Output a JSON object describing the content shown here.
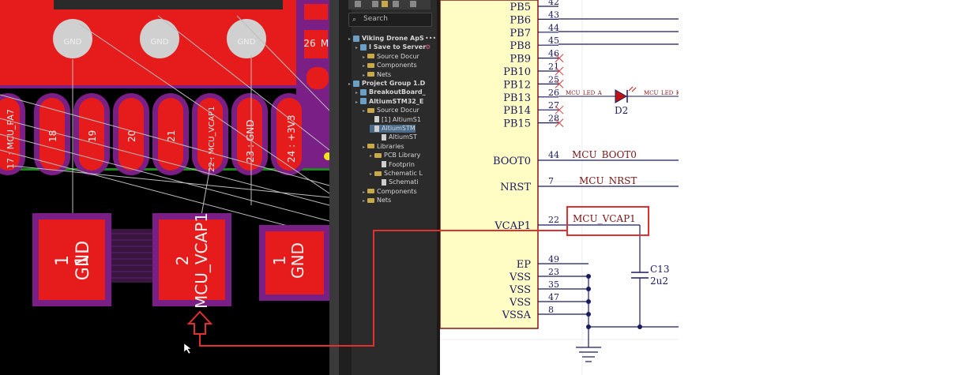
{
  "pcb": {
    "top_vias": [
      "GND",
      "GND",
      "GND"
    ],
    "pin26": "26",
    "pin26_suffix": "M",
    "pads": [
      {
        "num": "17",
        "net": "MCU_PA7"
      },
      {
        "num": "18",
        "net": ""
      },
      {
        "num": "19",
        "net": ""
      },
      {
        "num": "20",
        "net": ""
      },
      {
        "num": "21",
        "net": ""
      },
      {
        "num": "22",
        "net": "MCU_VCAP1"
      },
      {
        "num": "23",
        "net": "GND"
      },
      {
        "num": "24",
        "net": "+3V3"
      }
    ],
    "smd_pads": [
      {
        "num": "1",
        "net": "GND"
      },
      {
        "num": "2",
        "net": "MCU_VCAP1"
      },
      {
        "num": "1",
        "net": "GND"
      }
    ]
  },
  "projects": {
    "search_placeholder": "Search",
    "items": [
      {
        "label": "Viking Drone ApS",
        "indent": 0,
        "kind": "workspace",
        "suffix": "•••"
      },
      {
        "label": "I Save to Server",
        "indent": 1,
        "kind": "project",
        "suffix": "⚙"
      },
      {
        "label": "Source Docur",
        "indent": 2,
        "kind": "folder"
      },
      {
        "label": "Components",
        "indent": 2,
        "kind": "folder"
      },
      {
        "label": "Nets",
        "indent": 2,
        "kind": "folder"
      },
      {
        "label": "Project Group 1.D",
        "indent": 0,
        "kind": "project"
      },
      {
        "label": "BreakoutBoard_",
        "indent": 1,
        "kind": "project"
      },
      {
        "label": "AltiumSTM32_E",
        "indent": 1,
        "kind": "project"
      },
      {
        "label": "Source Docur",
        "indent": 2,
        "kind": "folder"
      },
      {
        "label": "[1] AltiumS1",
        "indent": 3,
        "kind": "doc"
      },
      {
        "label": "AltiumSTM",
        "indent": 3,
        "kind": "doc"
      },
      {
        "label": "AltiumST",
        "indent": 4,
        "kind": "doc"
      },
      {
        "label": "Libraries",
        "indent": 2,
        "kind": "folder"
      },
      {
        "label": "PCB Library",
        "indent": 3,
        "kind": "folder"
      },
      {
        "label": "Footprin",
        "indent": 4,
        "kind": "doc"
      },
      {
        "label": "Schematic L",
        "indent": 3,
        "kind": "folder"
      },
      {
        "label": "Schemati",
        "indent": 4,
        "kind": "doc"
      },
      {
        "label": "Components",
        "indent": 2,
        "kind": "folder"
      },
      {
        "label": "Nets",
        "indent": 2,
        "kind": "folder"
      }
    ]
  },
  "schematic": {
    "pins_pb": [
      {
        "name": "PB5",
        "num": "42"
      },
      {
        "name": "PB6",
        "num": "43"
      },
      {
        "name": "PB7",
        "num": "44"
      },
      {
        "name": "PB8",
        "num": "45"
      },
      {
        "name": "PB9",
        "num": "46"
      },
      {
        "name": "PB10",
        "num": "21"
      },
      {
        "name": "PB12",
        "num": "25"
      },
      {
        "name": "PB13",
        "num": "26"
      },
      {
        "name": "PB14",
        "num": "27"
      },
      {
        "name": "PB15",
        "num": "28"
      }
    ],
    "boot0": {
      "name": "BOOT0",
      "num": "44",
      "net": "MCU_BOOT0"
    },
    "nrst": {
      "name": "NRST",
      "num": "7",
      "net": "MCU_NRST"
    },
    "vcap1": {
      "name": "VCAP1",
      "num": "22",
      "net": "MCU_VCAP1"
    },
    "power_pins": [
      {
        "name": "EP",
        "num": "49"
      },
      {
        "name": "VSS",
        "num": "23"
      },
      {
        "name": "VSS",
        "num": "35"
      },
      {
        "name": "VSS",
        "num": "47"
      },
      {
        "name": "VSSA",
        "num": "8"
      }
    ],
    "led_net_a": "MCU_LED_A",
    "led_net_k": "MCU_LED_K",
    "diode": "D2",
    "cap_ref": "C13",
    "cap_val": "2u2"
  },
  "colors": {
    "pcb_red": "#ee1c1c",
    "pcb_purple": "#7a1f86",
    "highlight": "#e03030"
  }
}
